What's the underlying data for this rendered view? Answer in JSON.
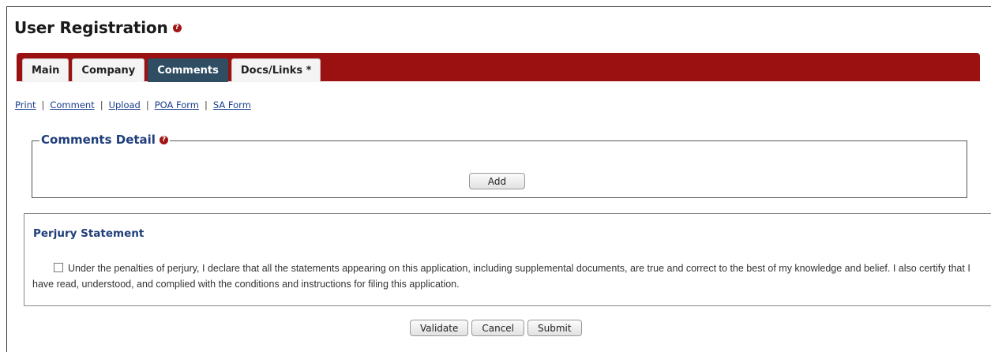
{
  "page": {
    "title": "User Registration",
    "help_icon": "help-icon"
  },
  "tabs": [
    {
      "label": "Main",
      "active": false
    },
    {
      "label": "Company",
      "active": false
    },
    {
      "label": "Comments",
      "active": true
    },
    {
      "label": "Docs/Links *",
      "active": false
    }
  ],
  "links": [
    "Print",
    "Comment",
    "Upload",
    "POA Form",
    "SA Form"
  ],
  "comments_detail": {
    "title": "Comments Detail",
    "add_label": "Add"
  },
  "perjury": {
    "heading": "Perjury Statement",
    "checked": false,
    "text": "Under the penalties of perjury, I declare that all the statements appearing on this application, including supplemental documents, are true and correct to the best of my knowledge and belief. I also certify that I have read, understood, and complied with the conditions and instructions for filing this application."
  },
  "actions": {
    "validate_label": "Validate",
    "cancel_label": "Cancel",
    "submit_label": "Submit"
  },
  "colors": {
    "tab_bar": "#9b1010",
    "active_tab": "#2f4d63",
    "heading_blue": "#1f3d7a",
    "link_blue": "#1a3e8c",
    "help_red": "#a01515"
  }
}
